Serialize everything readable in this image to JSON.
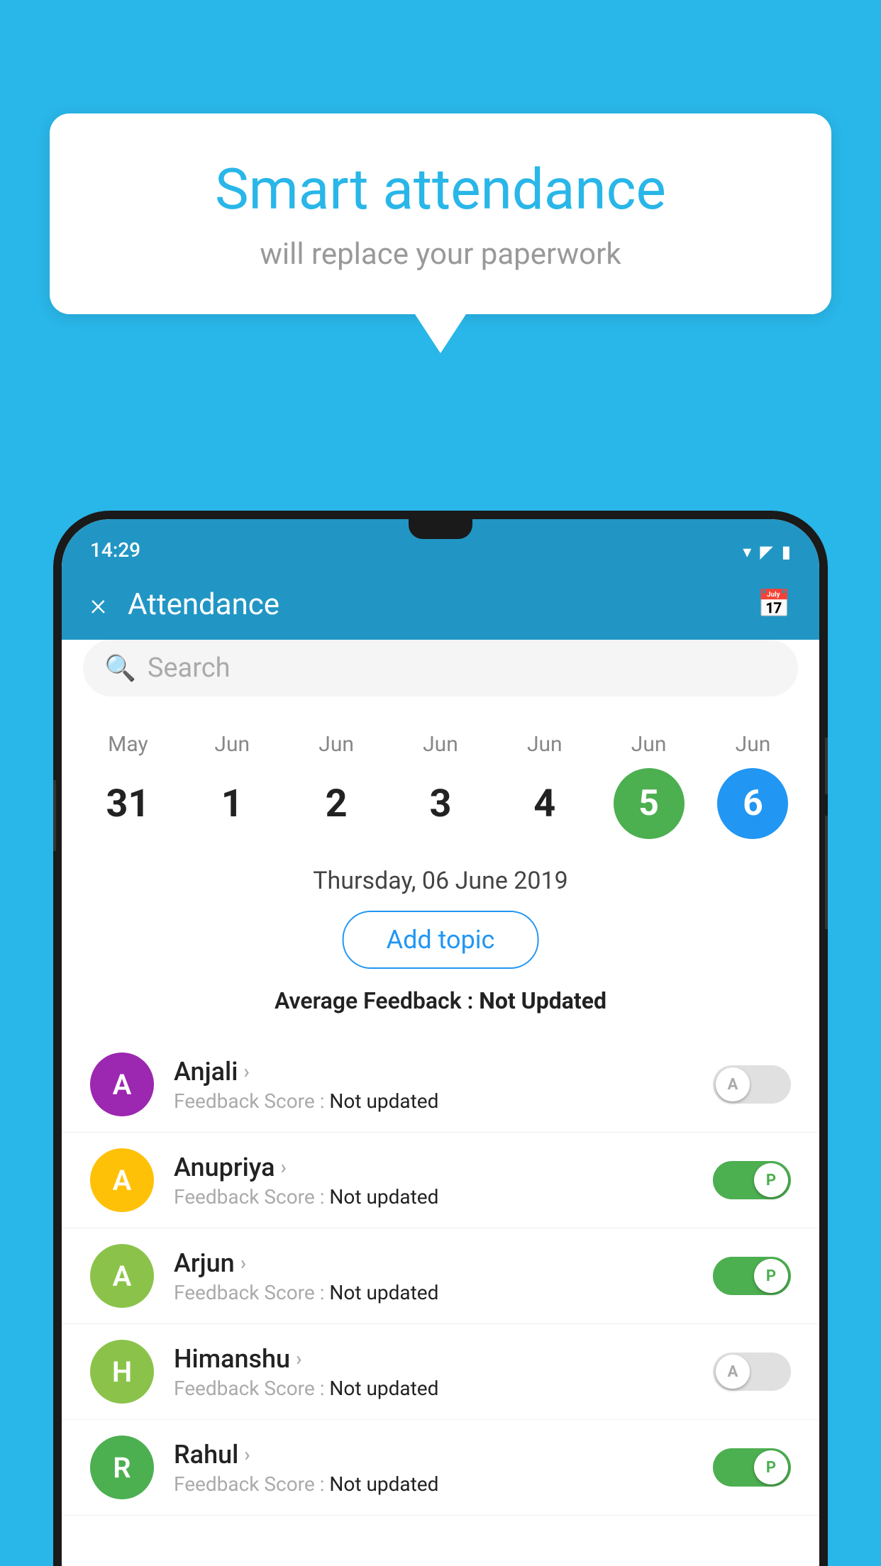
{
  "background_color": "#29b6e8",
  "bubble": {
    "title": "Smart attendance",
    "subtitle": "will replace your paperwork"
  },
  "app": {
    "status_time": "14:29",
    "title": "Attendance",
    "close_label": "×",
    "search_placeholder": "Search",
    "selected_date_label": "Thursday, 06 June 2019",
    "add_topic_label": "Add topic",
    "avg_feedback_label": "Average Feedback :",
    "avg_feedback_value": "Not Updated"
  },
  "calendar": [
    {
      "month": "May",
      "date": "31",
      "state": "normal"
    },
    {
      "month": "Jun",
      "date": "1",
      "state": "normal"
    },
    {
      "month": "Jun",
      "date": "2",
      "state": "normal"
    },
    {
      "month": "Jun",
      "date": "3",
      "state": "normal"
    },
    {
      "month": "Jun",
      "date": "4",
      "state": "normal"
    },
    {
      "month": "Jun",
      "date": "5",
      "state": "today"
    },
    {
      "month": "Jun",
      "date": "6",
      "state": "selected"
    }
  ],
  "students": [
    {
      "name": "Anjali",
      "avatar_letter": "A",
      "avatar_color": "#9c27b0",
      "feedback": "Not updated",
      "toggle": "off",
      "toggle_label": "A"
    },
    {
      "name": "Anupriya",
      "avatar_letter": "A",
      "avatar_color": "#ffc107",
      "feedback": "Not updated",
      "toggle": "on",
      "toggle_label": "P"
    },
    {
      "name": "Arjun",
      "avatar_letter": "A",
      "avatar_color": "#8bc34a",
      "feedback": "Not updated",
      "toggle": "on",
      "toggle_label": "P"
    },
    {
      "name": "Himanshu",
      "avatar_letter": "H",
      "avatar_color": "#8bc34a",
      "feedback": "Not updated",
      "toggle": "off",
      "toggle_label": "A"
    },
    {
      "name": "Rahul",
      "avatar_letter": "R",
      "avatar_color": "#4caf50",
      "feedback": "Not updated",
      "toggle": "on",
      "toggle_label": "P"
    }
  ]
}
